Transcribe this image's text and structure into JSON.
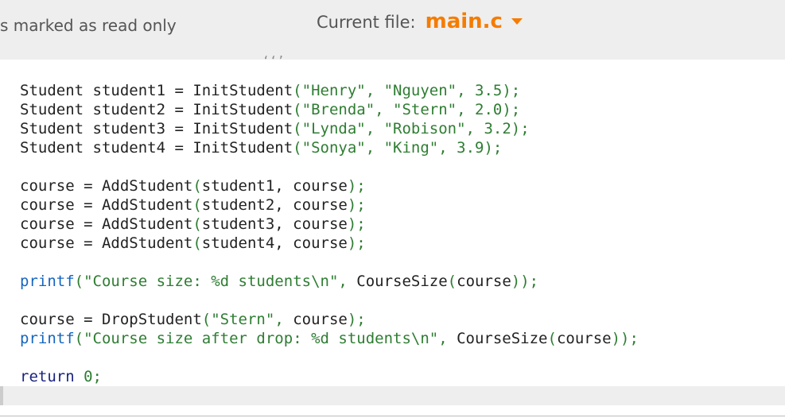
{
  "header": {
    "readonly_notice": "s marked as read only",
    "current_file_label": "Current file:",
    "current_file_name": "main.c"
  },
  "editor": {
    "cut_fragment": "‘‘’",
    "lines": [
      [
        {
          "t": "Student student1 = InitStudent",
          "c": "fn"
        },
        {
          "t": "(",
          "c": "punct"
        },
        {
          "t": "\"Henry\"",
          "c": "str"
        },
        {
          "t": ", ",
          "c": "punct"
        },
        {
          "t": "\"Nguyen\"",
          "c": "str"
        },
        {
          "t": ", ",
          "c": "punct"
        },
        {
          "t": "3.5",
          "c": "num"
        },
        {
          "t": ");",
          "c": "punct"
        }
      ],
      [
        {
          "t": "Student student2 = InitStudent",
          "c": "fn"
        },
        {
          "t": "(",
          "c": "punct"
        },
        {
          "t": "\"Brenda\"",
          "c": "str"
        },
        {
          "t": ", ",
          "c": "punct"
        },
        {
          "t": "\"Stern\"",
          "c": "str"
        },
        {
          "t": ", ",
          "c": "punct"
        },
        {
          "t": "2.0",
          "c": "num"
        },
        {
          "t": ");",
          "c": "punct"
        }
      ],
      [
        {
          "t": "Student student3 = InitStudent",
          "c": "fn"
        },
        {
          "t": "(",
          "c": "punct"
        },
        {
          "t": "\"Lynda\"",
          "c": "str"
        },
        {
          "t": ", ",
          "c": "punct"
        },
        {
          "t": "\"Robison\"",
          "c": "str"
        },
        {
          "t": ", ",
          "c": "punct"
        },
        {
          "t": "3.2",
          "c": "num"
        },
        {
          "t": ");",
          "c": "punct"
        }
      ],
      [
        {
          "t": "Student student4 = InitStudent",
          "c": "fn"
        },
        {
          "t": "(",
          "c": "punct"
        },
        {
          "t": "\"Sonya\"",
          "c": "str"
        },
        {
          "t": ", ",
          "c": "punct"
        },
        {
          "t": "\"King\"",
          "c": "str"
        },
        {
          "t": ", ",
          "c": "punct"
        },
        {
          "t": "3.9",
          "c": "num"
        },
        {
          "t": ");",
          "c": "punct"
        }
      ],
      [],
      [
        {
          "t": "course = AddStudent",
          "c": "fn"
        },
        {
          "t": "(",
          "c": "punct"
        },
        {
          "t": "student1, course",
          "c": "fn"
        },
        {
          "t": ");",
          "c": "punct"
        }
      ],
      [
        {
          "t": "course = AddStudent",
          "c": "fn"
        },
        {
          "t": "(",
          "c": "punct"
        },
        {
          "t": "student2, course",
          "c": "fn"
        },
        {
          "t": ");",
          "c": "punct"
        }
      ],
      [
        {
          "t": "course = AddStudent",
          "c": "fn"
        },
        {
          "t": "(",
          "c": "punct"
        },
        {
          "t": "student3, course",
          "c": "fn"
        },
        {
          "t": ");",
          "c": "punct"
        }
      ],
      [
        {
          "t": "course = AddStudent",
          "c": "fn"
        },
        {
          "t": "(",
          "c": "punct"
        },
        {
          "t": "student4, course",
          "c": "fn"
        },
        {
          "t": ");",
          "c": "punct"
        }
      ],
      [],
      [
        {
          "t": "printf",
          "c": "printf"
        },
        {
          "t": "(",
          "c": "punct"
        },
        {
          "t": "\"Course size: %d students\\n\"",
          "c": "str"
        },
        {
          "t": ", ",
          "c": "punct"
        },
        {
          "t": "CourseSize",
          "c": "fn"
        },
        {
          "t": "(",
          "c": "punct"
        },
        {
          "t": "course",
          "c": "fn"
        },
        {
          "t": "));",
          "c": "punct"
        }
      ],
      [],
      [
        {
          "t": "course = DropStudent",
          "c": "fn"
        },
        {
          "t": "(",
          "c": "punct"
        },
        {
          "t": "\"Stern\"",
          "c": "str"
        },
        {
          "t": ", ",
          "c": "punct"
        },
        {
          "t": "course",
          "c": "fn"
        },
        {
          "t": ");",
          "c": "punct"
        }
      ],
      [
        {
          "t": "printf",
          "c": "printf"
        },
        {
          "t": "(",
          "c": "punct"
        },
        {
          "t": "\"Course size after drop: %d students\\n\"",
          "c": "str"
        },
        {
          "t": ", ",
          "c": "punct"
        },
        {
          "t": "CourseSize",
          "c": "fn"
        },
        {
          "t": "(",
          "c": "punct"
        },
        {
          "t": "course",
          "c": "fn"
        },
        {
          "t": "));",
          "c": "punct"
        }
      ],
      [],
      [
        {
          "t": "return",
          "c": "kw"
        },
        {
          "t": " ",
          "c": "fn"
        },
        {
          "t": "0",
          "c": "num"
        },
        {
          "t": ";",
          "c": "punct"
        }
      ]
    ]
  },
  "colors": {
    "accent": "#f57c00",
    "topbar_bg": "#eeeeee",
    "string": "#2e7d32",
    "keyword": "#1a237e"
  },
  "icons": {
    "file_dropdown": "caret-down-icon"
  }
}
